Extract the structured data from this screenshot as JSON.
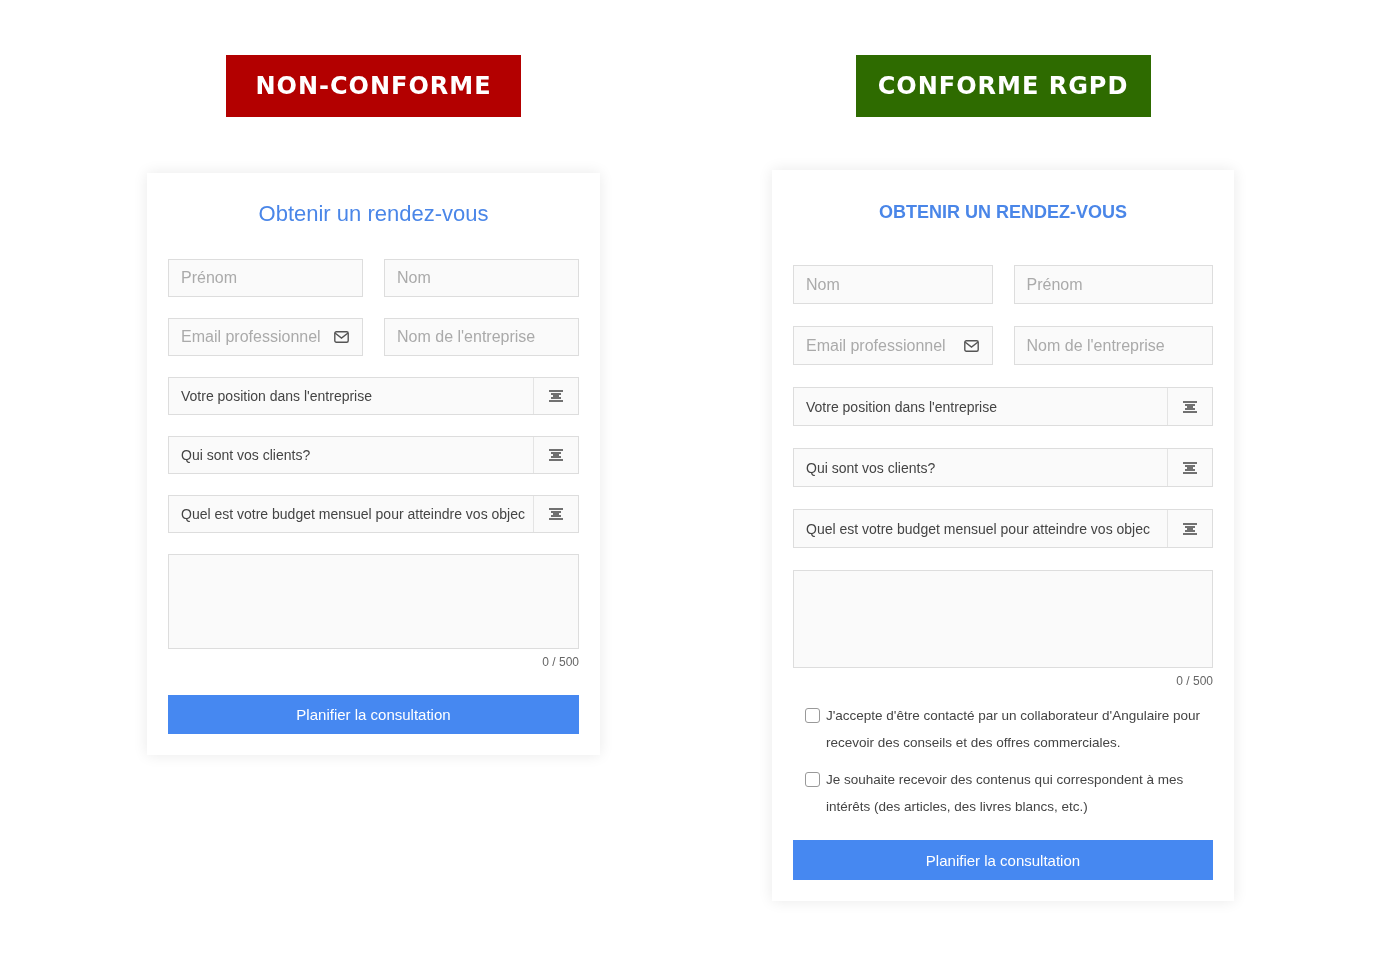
{
  "panels": [
    {
      "badge": {
        "label": "NON-CONFORME",
        "color": "#b30000"
      },
      "title": "Obtenir un rendez-vous",
      "fields": [
        {
          "kind": "text",
          "placeholder": "Prénom"
        },
        {
          "kind": "text",
          "placeholder": "Nom"
        },
        {
          "kind": "email",
          "placeholder": "Email professionnel"
        },
        {
          "kind": "text",
          "placeholder": "Nom de l'entreprise"
        },
        {
          "kind": "select",
          "value": "Votre position dans l'entreprise"
        },
        {
          "kind": "select",
          "value": "Qui sont vos clients?"
        },
        {
          "kind": "select",
          "value": "Quel est votre budget mensuel pour atteindre vos objec"
        },
        {
          "kind": "textarea",
          "counter": "0 / 500"
        }
      ],
      "button": "Planifier la consultation"
    },
    {
      "badge": {
        "label": "CONFORME RGPD",
        "color": "#2e6b00"
      },
      "title": "OBTENIR UN RENDEZ-VOUS",
      "fields": [
        {
          "kind": "text",
          "placeholder": "Nom"
        },
        {
          "kind": "text",
          "placeholder": "Prénom"
        },
        {
          "kind": "email",
          "placeholder": "Email professionnel"
        },
        {
          "kind": "text",
          "placeholder": "Nom de l'entreprise"
        },
        {
          "kind": "select",
          "value": "Votre position dans l'entreprise"
        },
        {
          "kind": "select",
          "value": "Qui sont vos clients?"
        },
        {
          "kind": "select",
          "value": "Quel est votre budget mensuel pour atteindre vos objec"
        },
        {
          "kind": "textarea",
          "counter": "0 / 500"
        }
      ],
      "checkboxes": [
        {
          "label": "J'accepte d'être contacté par un collaborateur d'Angulaire pour recevoir des conseils et des offres commerciales.",
          "checked": false
        },
        {
          "label": "Je souhaite recevoir des contenus qui correspondent à mes intérêts (des articles, des livres blancs, etc.)",
          "checked": false
        }
      ],
      "button": "Planifier la consultation"
    }
  ]
}
